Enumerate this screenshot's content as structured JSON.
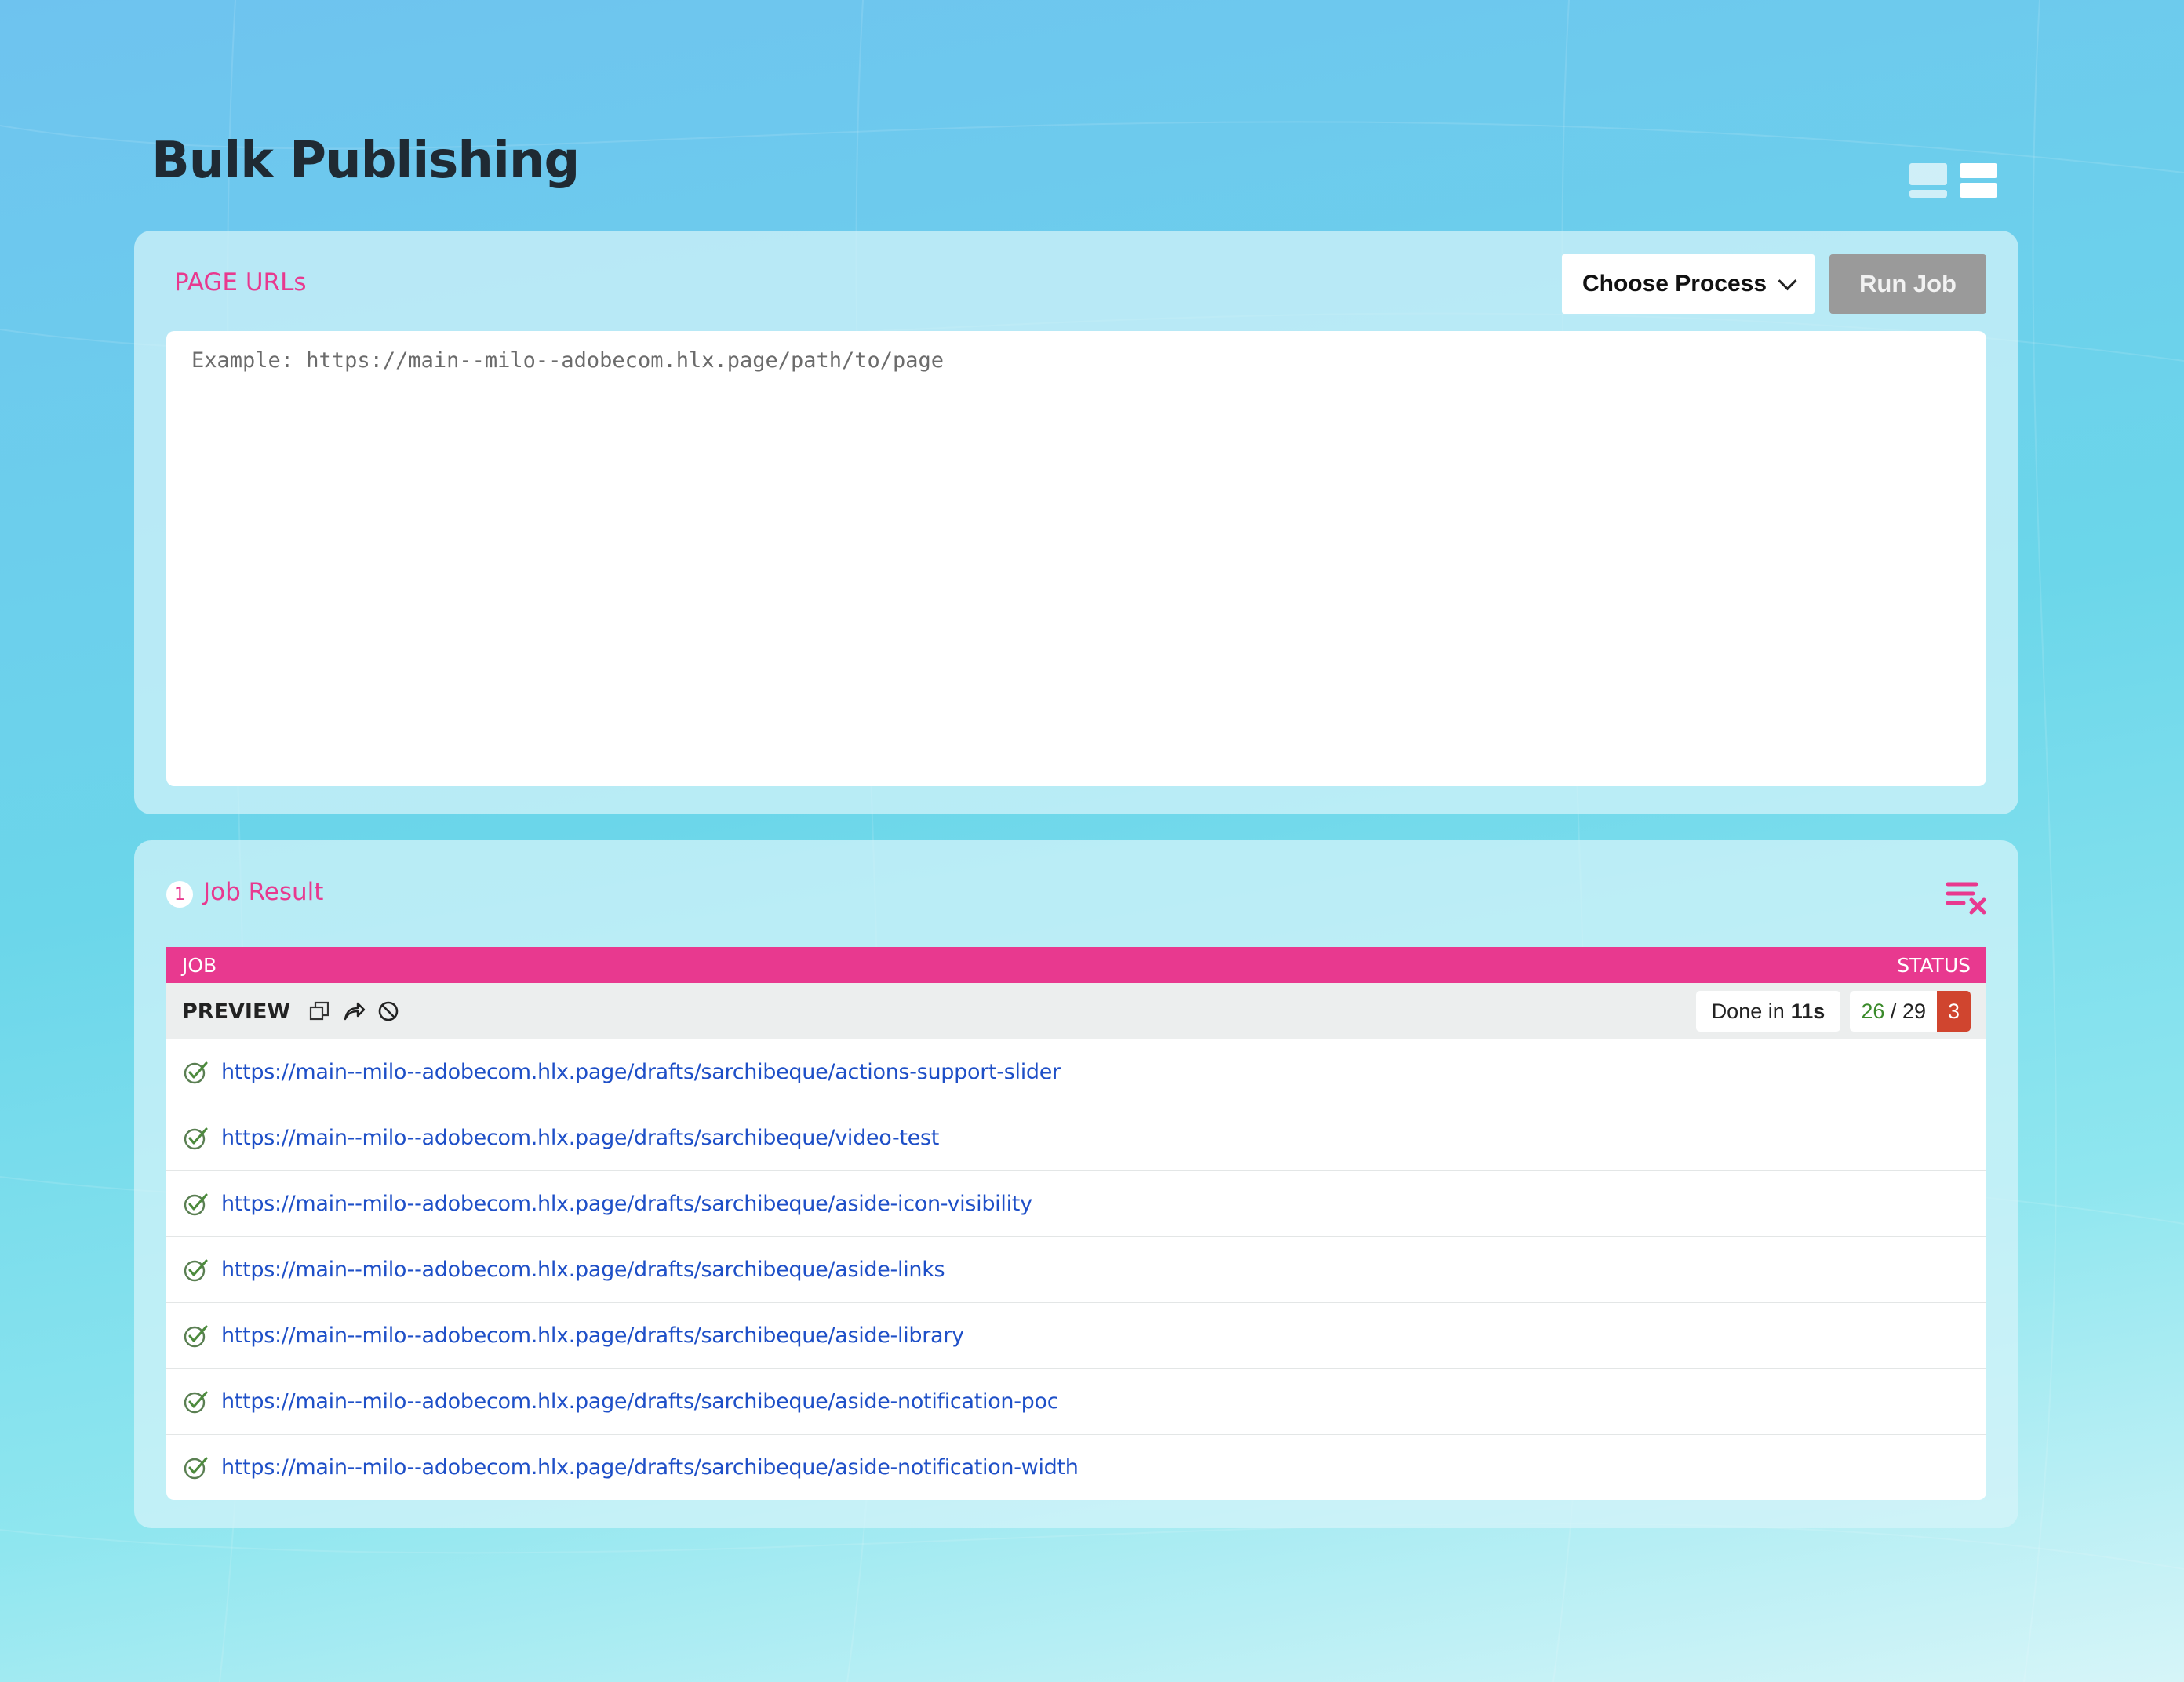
{
  "page": {
    "title": "Bulk Publishing"
  },
  "layout_toggles": [
    "split-layout-icon",
    "stacked-layout-icon"
  ],
  "urls_panel": {
    "label": "PAGE URLs",
    "choose_process_label": "Choose Process",
    "run_job_label": "Run Job",
    "textarea_value": "",
    "textarea_placeholder": "Example: https://main--milo--adobecom.hlx.page/path/to/page"
  },
  "results_panel": {
    "count": "1",
    "label": "Job Result",
    "clear_icon": "clear-list-icon",
    "table": {
      "col_job": "JOB",
      "col_status": "STATUS"
    },
    "job": {
      "name": "PREVIEW",
      "icons": [
        "copy-icon",
        "share-icon",
        "cancel-icon"
      ],
      "done_prefix": "Done in",
      "done_time": "11s",
      "success_count": "26",
      "separator": "/",
      "total_count": "29",
      "error_count": "3",
      "urls": [
        "https://main--milo--adobecom.hlx.page/drafts/sarchibeque/actions-support-slider",
        "https://main--milo--adobecom.hlx.page/drafts/sarchibeque/video-test",
        "https://main--milo--adobecom.hlx.page/drafts/sarchibeque/aside-icon-visibility",
        "https://main--milo--adobecom.hlx.page/drafts/sarchibeque/aside-links",
        "https://main--milo--adobecom.hlx.page/drafts/sarchibeque/aside-library",
        "https://main--milo--adobecom.hlx.page/drafts/sarchibeque/aside-notification-poc",
        "https://main--milo--adobecom.hlx.page/drafts/sarchibeque/aside-notification-width"
      ]
    }
  },
  "colors": {
    "accent": "#e8398f",
    "link": "#1e4fc7",
    "success": "#3a8a2a",
    "error": "#d0452f",
    "run_button_disabled": "#9a9a9a"
  }
}
